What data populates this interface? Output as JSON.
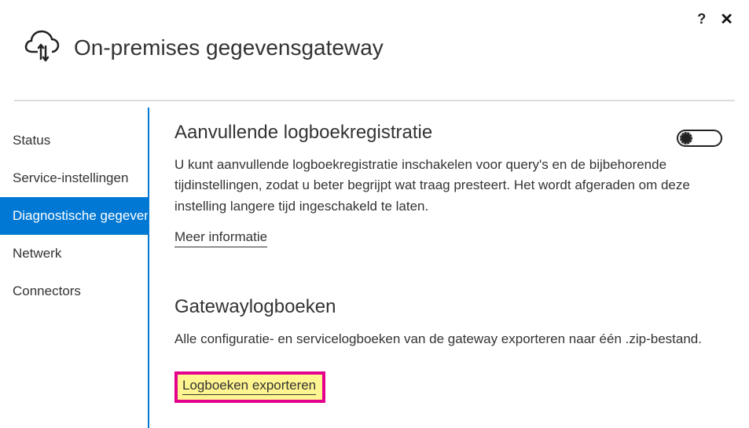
{
  "titlebar": {
    "help_label": "?",
    "close_label": "✕"
  },
  "header": {
    "title": "On-premises gegevensgateway"
  },
  "sidebar": {
    "items": [
      {
        "label": "Status",
        "active": false
      },
      {
        "label": "Service-instellingen",
        "active": false
      },
      {
        "label": "Diagnostische gegevens",
        "active": true
      },
      {
        "label": "Netwerk",
        "active": false
      },
      {
        "label": "Connectors",
        "active": false
      }
    ]
  },
  "main": {
    "logging": {
      "title": "Aanvullende logboekregistratie",
      "toggle_state": "off",
      "description": "U kunt aanvullende logboekregistratie inschakelen voor query's en de bijbehorende tijdinstellingen, zodat u beter begrijpt wat traag presteert. Het wordt afgeraden om deze instelling langere tijd ingeschakeld te laten.",
      "more_info": "Meer informatie"
    },
    "logs": {
      "title": "Gatewaylogboeken",
      "description": "Alle configuratie- en servicelogboeken van de gateway exporteren naar één .zip-bestand.",
      "export_label": "Logboeken exporteren"
    }
  }
}
